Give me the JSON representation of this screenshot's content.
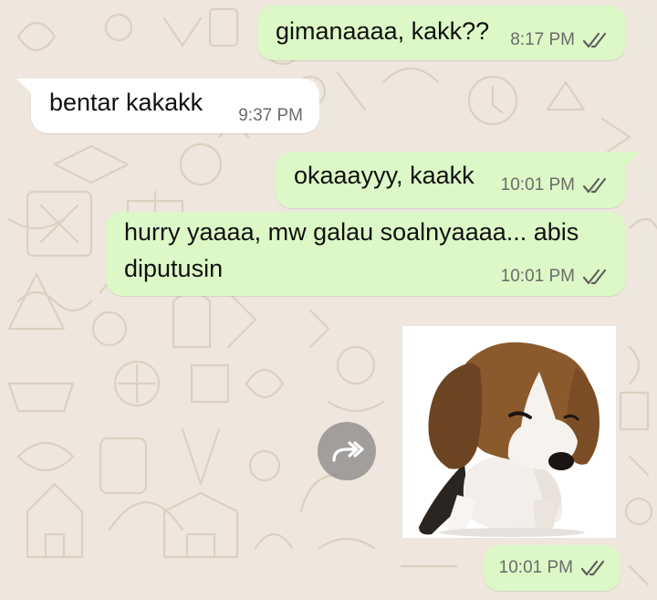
{
  "messages": [
    {
      "direction": "outgoing",
      "text": "gimanaaaa, kakk??",
      "time": "8:17 PM",
      "status": "read-double-check"
    },
    {
      "direction": "incoming",
      "text": "bentar kakakk",
      "time": "9:37 PM"
    },
    {
      "direction": "outgoing",
      "text": "okaaayyy, kaakk",
      "time": "10:01 PM",
      "status": "read-double-check"
    },
    {
      "direction": "outgoing",
      "text_line1": "hurry yaaaa, mw galau soalnyaaaa... abis",
      "text_line2": "diputusin",
      "time": "10:01 PM",
      "status": "read-double-check"
    },
    {
      "direction": "outgoing",
      "type": "sticker",
      "sticker": "sad-beagle-puppy",
      "time": "10:01 PM",
      "status": "read-double-check"
    }
  ],
  "forward_icon": "forward-arrow-icon",
  "colors": {
    "background": "#efe7dd",
    "outgoing_bubble": "#dcf8c6",
    "incoming_bubble": "#ffffff",
    "timestamp": "#6b6b6b",
    "doodle": "#dcd0c0"
  }
}
